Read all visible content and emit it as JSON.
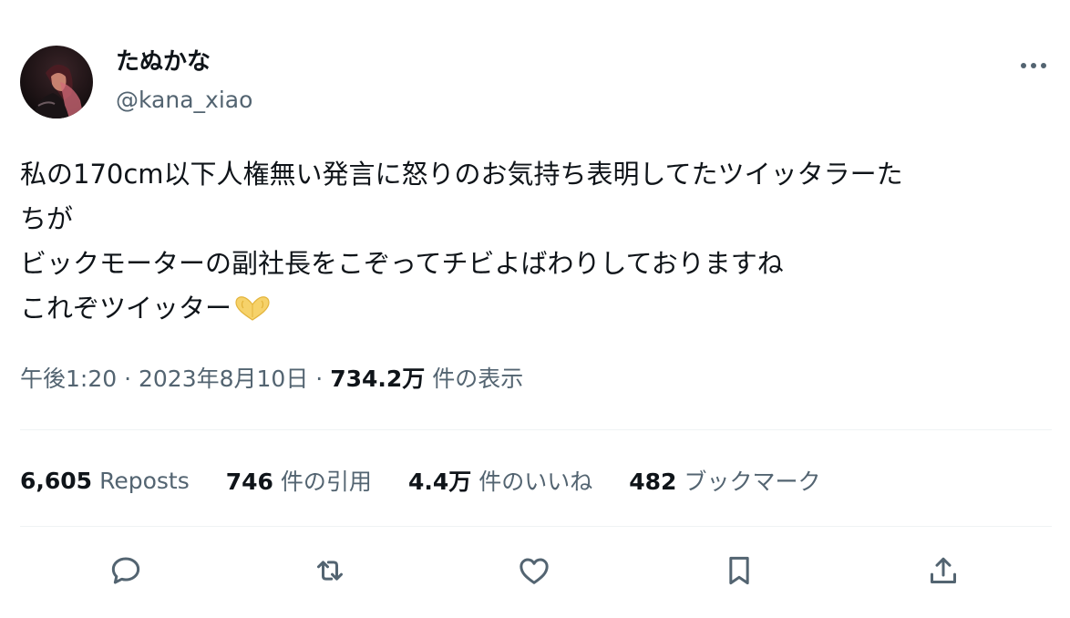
{
  "author": {
    "display_name": "たぬかな",
    "handle": "@kana_xiao",
    "avatar_icon": "profile-photo"
  },
  "tweet": {
    "lines": [
      "私の170cm以下人権無い発言に怒りのお気持ち表明してたツイッタラーた",
      "ちが",
      "ビックモーターの副社長をこぞってチビよばわりしておりますね",
      "これぞツイッター"
    ],
    "emoji_icon": "heart-hands-emoji"
  },
  "meta": {
    "time": "午後1:20",
    "separator": "·",
    "date": "2023年8月10日",
    "views_count": "734.2万",
    "views_label": "件の表示"
  },
  "stats": {
    "reposts": {
      "count": "6,605",
      "label": "Reposts"
    },
    "quotes": {
      "count": "746",
      "label": "件の引用"
    },
    "likes": {
      "count": "4.4万",
      "label": "件のいいね"
    },
    "bookmarks": {
      "count": "482",
      "label": "ブックマーク"
    }
  },
  "actions": [
    "reply-icon",
    "repost-icon",
    "like-icon",
    "bookmark-icon",
    "share-icon"
  ],
  "colors": {
    "text": "#0f1419",
    "secondary": "#536471",
    "divider": "#eff3f4",
    "icon": "#536471",
    "emoji": "#f5cd5b"
  }
}
